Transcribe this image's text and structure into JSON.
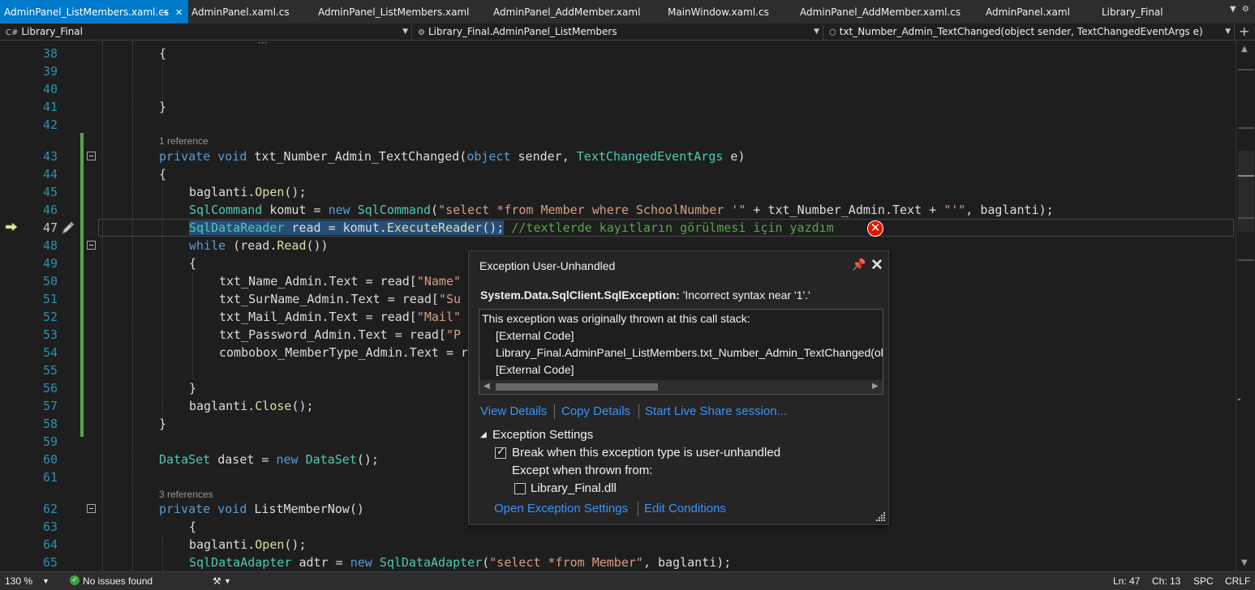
{
  "tabs": [
    {
      "label": "AdminPanel_ListMembers.xaml.cs",
      "active": true
    },
    {
      "label": "AdminPanel.xaml.cs"
    },
    {
      "label": "AdminPanel_ListMembers.xaml"
    },
    {
      "label": "AdminPanel_AddMember.xaml"
    },
    {
      "label": "MainWindow.xaml.cs"
    },
    {
      "label": "AdminPanel_AddMember.xaml.cs"
    },
    {
      "label": "AdminPanel.xaml"
    },
    {
      "label": "Library_Final"
    }
  ],
  "tab_icons": {
    "pin": "pin-icon",
    "close": "close-icon",
    "overflow": "chevron-down-icon"
  },
  "nav": {
    "project": "Library_Final",
    "class": "Library_Final.AdminPanel_ListMembers",
    "member": "txt_Number_Admin_TextChanged(object sender, TextChangedEventArgs e)"
  },
  "editor": {
    "current_line": 47,
    "line_numbers": [
      "38",
      "39",
      "40",
      "41",
      "42",
      "43",
      "44",
      "45",
      "46",
      "47",
      "48",
      "49",
      "50",
      "51",
      "52",
      "53",
      "54",
      "55",
      "56",
      "57",
      "58",
      "59",
      "60",
      "61",
      "62",
      "63",
      "64",
      "65"
    ],
    "ref_labels": [
      "1 reference",
      "3 references"
    ],
    "lines": {
      "l38": "{",
      "l41": "}",
      "l43": {
        "p1": "private void ",
        "p2": "txt_Number_Admin_TextChanged(",
        "p3": "object",
        "p4": " sender, ",
        "p5": "TextChangedEventArgs",
        "p6": " e)"
      },
      "l44": "{",
      "l45": {
        "p1": "baglanti.",
        "p2": "Open",
        "p3": "();"
      },
      "l46": {
        "p1": "SqlCommand",
        "p2": " komut = ",
        "p3": "new",
        "p4": " ",
        "p5": "SqlCommand",
        "p6": "(",
        "p7": "\"select *from Member where SchoolNumber '\"",
        "p8": " + txt_Number_Admin.Text + ",
        "p9": "\"'\"",
        "p10": ", baglanti);"
      },
      "l47": {
        "p1": "SqlDataReader",
        "p2": " read = komut.",
        "p3": "ExecuteReader",
        "p4": "();",
        "p5": " //textlerde kayıtların görülmesi için yazdım"
      },
      "l48": {
        "p1": "while",
        "p2": " (read.",
        "p3": "Read",
        "p4": "())"
      },
      "l49": "{",
      "l50": {
        "p1": "txt_Name_Admin.Text = read[",
        "p2": "\"Name\""
      },
      "l51": {
        "p1": "txt_SurName_Admin.Text = read[",
        "p2": "\"Su"
      },
      "l52": {
        "p1": "txt_Mail_Admin.Text = read[",
        "p2": "\"Mail\""
      },
      "l53": {
        "p1": "txt_Password_Admin.Text = read[",
        "p2": "\"P"
      },
      "l54": "combobox_MemberType_Admin.Text = r",
      "l56": "}",
      "l57": {
        "p1": "baglanti.",
        "p2": "Close",
        "p3": "();"
      },
      "l58": "}",
      "l60": {
        "p1": "DataSet",
        "p2": " daset = ",
        "p3": "new",
        "p4": " ",
        "p5": "DataSet",
        "p6": "();"
      },
      "l62": {
        "p1": "private void ",
        "p2": "ListMemberNow",
        "p3": "()"
      },
      "l63": "{",
      "l64": {
        "p1": "baglanti.",
        "p2": "Open",
        "p3": "();"
      },
      "l65": {
        "p1": "SqlDataAdapter",
        "p2": " adtr = ",
        "p3": "new",
        "p4": " ",
        "p5": "SqlDataAdapter",
        "p6": "(",
        "p7": "\"select *from Member\"",
        "p8": ", baglanti);"
      }
    }
  },
  "exception": {
    "title": "Exception User-Unhandled",
    "type": "System.Data.SqlClient.SqlException:",
    "message": "'Incorrect syntax near '1'.'",
    "stack_header": "This exception was originally thrown at this call stack:",
    "stack": [
      "[External Code]",
      "Library_Final.AdminPanel_ListMembers.txt_Number_Admin_TextChanged(object, System.Windows.Controls.TextChangedEventArgs)",
      "[External Code]"
    ],
    "links": [
      "View Details",
      "Copy Details",
      "Start Live Share session..."
    ],
    "settings_label": "Exception Settings",
    "break_label": "Break when this exception type is user-unhandled",
    "break_checked": true,
    "except_label": "Except when thrown from:",
    "dll_label": "Library_Final.dll",
    "dll_checked": false,
    "bottom_links": [
      "Open Exception Settings",
      "Edit Conditions"
    ]
  },
  "status": {
    "zoom": "130 %",
    "issues": "No issues found",
    "ln": "Ln: 47",
    "ch": "Ch: 13",
    "spc": "SPC",
    "crlf": "CRLF"
  },
  "colors": {
    "accent": "#007acc",
    "keyword": "#569cd6",
    "type": "#4ec9b0",
    "string": "#d69d85",
    "comment": "#57a64a",
    "method": "#dcdcaa",
    "error": "#e51400",
    "link": "#3794ff"
  }
}
